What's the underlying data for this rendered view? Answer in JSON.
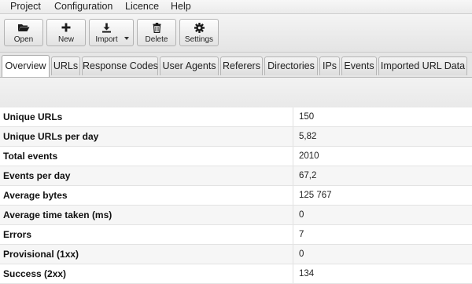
{
  "menu": [
    "Project",
    "Configuration",
    "Licence",
    "Help"
  ],
  "toolbar": {
    "open": "Open",
    "new": "New",
    "import": "Import",
    "delete": "Delete",
    "settings": "Settings"
  },
  "tabs": [
    "Overview",
    "URLs",
    "Response Codes",
    "User Agents",
    "Referers",
    "Directories",
    "IPs",
    "Events",
    "Imported URL Data"
  ],
  "stats": [
    {
      "label": "Unique URLs",
      "value": "150"
    },
    {
      "label": "Unique URLs per day",
      "value": "5,82"
    },
    {
      "label": "Total events",
      "value": "2010"
    },
    {
      "label": "Events per day",
      "value": "67,2"
    },
    {
      "label": "Average bytes",
      "value": "125 767"
    },
    {
      "label": "Average time taken (ms)",
      "value": "0"
    },
    {
      "label": "Errors",
      "value": "7"
    },
    {
      "label": "Provisional (1xx)",
      "value": "0"
    },
    {
      "label": "Success (2xx)",
      "value": "134"
    }
  ]
}
